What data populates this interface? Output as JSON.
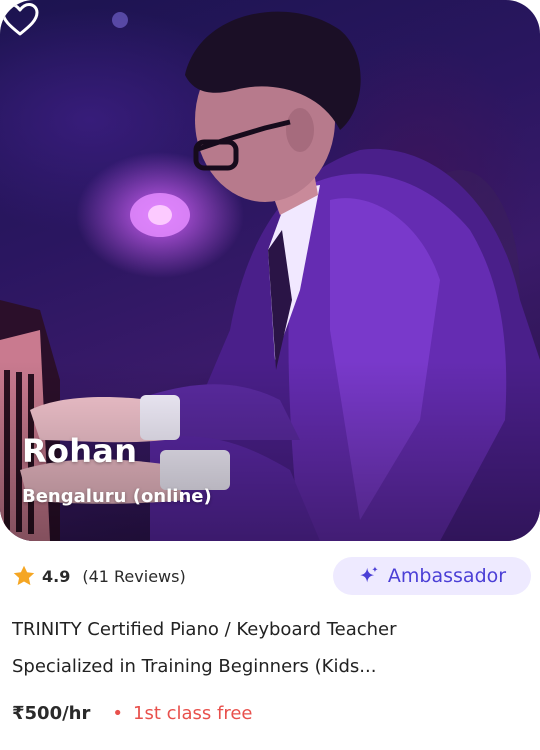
{
  "teacher": {
    "name": "Rohan",
    "location": "Bengaluru (online)",
    "rating": "4.9",
    "reviews": "(41 Reviews)",
    "badge": "Ambassador",
    "description_line1": "TRINITY Certified Piano / Keyboard Teacher",
    "description_line2": "Specialized in Training Beginners (Kids...",
    "price": "₹500/hr",
    "separator": "•",
    "offer": "1st class free"
  },
  "icons": {
    "favorite": "heart-outline-icon",
    "rating": "star-icon",
    "badge": "sparkle-icon"
  },
  "colors": {
    "accent": "#4b3fd6",
    "badge_bg": "#eeeaff",
    "star": "#f5a623",
    "offer": "#e8504c",
    "text": "#222222"
  }
}
